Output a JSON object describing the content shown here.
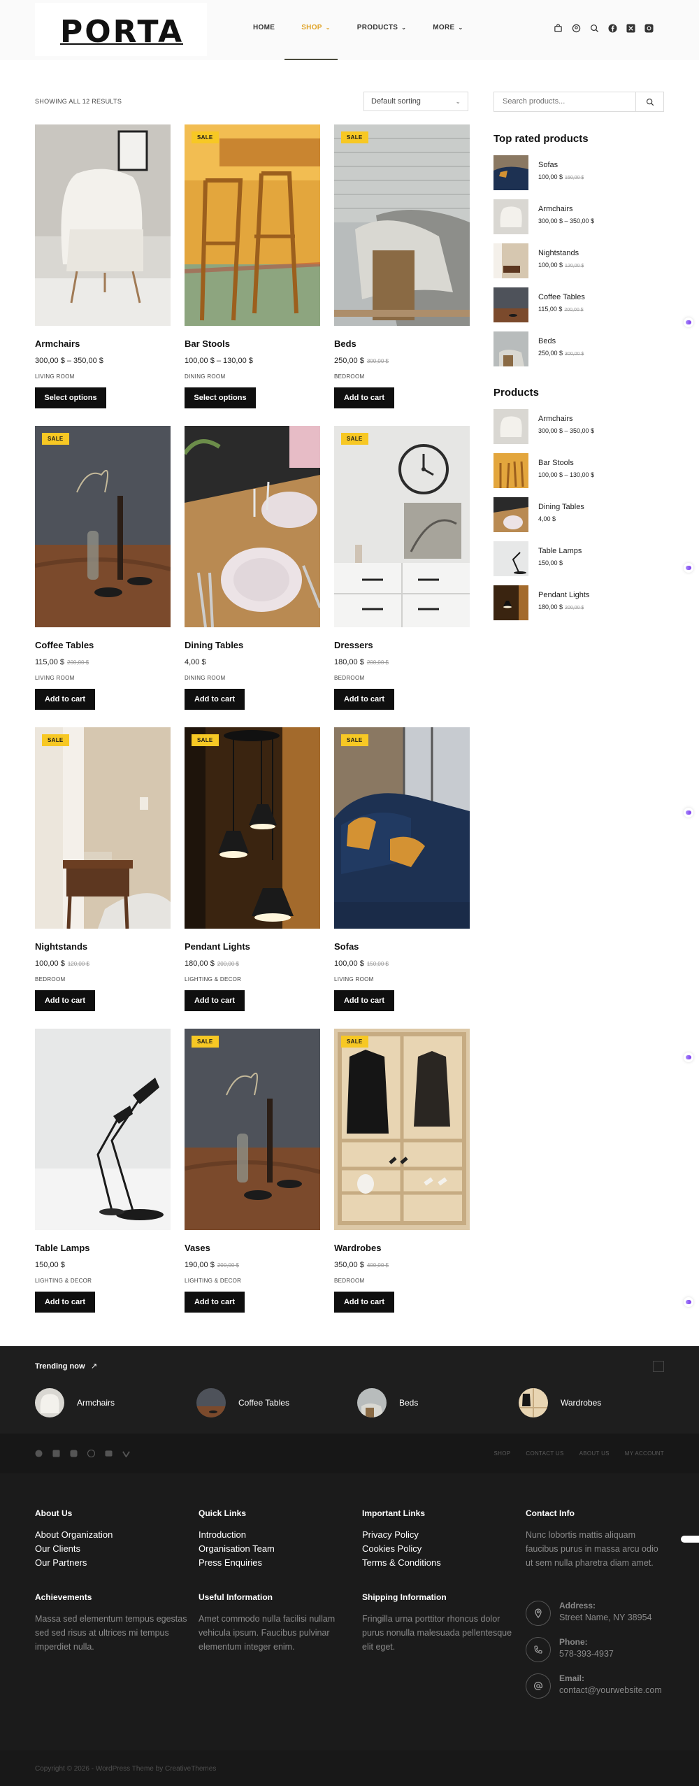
{
  "brand": {
    "logo": "PORTA"
  },
  "nav": {
    "items": [
      {
        "label": "HOME"
      },
      {
        "label": "SHOP"
      },
      {
        "label": "PRODUCTS"
      },
      {
        "label": "MORE"
      }
    ],
    "active": "SHOP",
    "accent_color": "#e0a429"
  },
  "header_icons": [
    "cart-icon",
    "account-icon",
    "search-icon",
    "facebook-icon",
    "x-icon",
    "instagram-icon"
  ],
  "toolbar": {
    "results_text": "SHOWING ALL 12 RESULTS",
    "sort_value": "Default sorting"
  },
  "products": [
    {
      "name": "Armchairs",
      "price": "300,00 $ – 350,00 $",
      "old_price": "",
      "category": "LIVING ROOM",
      "button": "Select options",
      "sale": false
    },
    {
      "name": "Bar Stools",
      "price": "100,00 $ – 130,00 $",
      "old_price": "",
      "category": "DINING ROOM",
      "button": "Select options",
      "sale": true
    },
    {
      "name": "Beds",
      "price": "250,00 $",
      "old_price": "300,00 $",
      "category": "BEDROOM",
      "button": "Add to cart",
      "sale": true
    },
    {
      "name": "Coffee Tables",
      "price": "115,00 $",
      "old_price": "200,00 $",
      "category": "LIVING ROOM",
      "button": "Add to cart",
      "sale": true
    },
    {
      "name": "Dining Tables",
      "price": "4,00 $",
      "old_price": "",
      "category": "DINING ROOM",
      "button": "Add to cart",
      "sale": false
    },
    {
      "name": "Dressers",
      "price": "180,00 $",
      "old_price": "200,00 $",
      "category": "BEDROOM",
      "button": "Add to cart",
      "sale": true
    },
    {
      "name": "Nightstands",
      "price": "100,00 $",
      "old_price": "120,00 $",
      "category": "BEDROOM",
      "button": "Add to cart",
      "sale": true
    },
    {
      "name": "Pendant Lights",
      "price": "180,00 $",
      "old_price": "200,00 $",
      "category": "LIGHTING & DECOR",
      "button": "Add to cart",
      "sale": true
    },
    {
      "name": "Sofas",
      "price": "100,00 $",
      "old_price": "150,00 $",
      "category": "LIVING ROOM",
      "button": "Add to cart",
      "sale": true
    },
    {
      "name": "Table Lamps",
      "price": "150,00 $",
      "old_price": "",
      "category": "LIGHTING & DECOR",
      "button": "Add to cart",
      "sale": false
    },
    {
      "name": "Vases",
      "price": "190,00 $",
      "old_price": "200,00 $",
      "category": "LIGHTING & DECOR",
      "button": "Add to cart",
      "sale": true
    },
    {
      "name": "Wardrobes",
      "price": "350,00 $",
      "old_price": "400,00 $",
      "category": "BEDROOM",
      "button": "Add to cart",
      "sale": true
    }
  ],
  "sale_label": "SALE",
  "sidebar": {
    "search_placeholder": "Search products...",
    "top_rated_title": "Top rated products",
    "top_rated": [
      {
        "name": "Sofas",
        "price": "100,00 $",
        "old_price": "150,00 $"
      },
      {
        "name": "Armchairs",
        "price": "300,00 $ – 350,00 $",
        "old_price": ""
      },
      {
        "name": "Nightstands",
        "price": "100,00 $",
        "old_price": "120,00 $"
      },
      {
        "name": "Coffee Tables",
        "price": "115,00 $",
        "old_price": "200,00 $"
      },
      {
        "name": "Beds",
        "price": "250,00 $",
        "old_price": "300,00 $"
      }
    ],
    "products_title": "Products",
    "products": [
      {
        "name": "Armchairs",
        "price": "300,00 $ – 350,00 $",
        "old_price": ""
      },
      {
        "name": "Bar Stools",
        "price": "100,00 $ – 130,00 $",
        "old_price": ""
      },
      {
        "name": "Dining Tables",
        "price": "4,00 $",
        "old_price": ""
      },
      {
        "name": "Table Lamps",
        "price": "150,00 $",
        "old_price": ""
      },
      {
        "name": "Pendant Lights",
        "price": "180,00 $",
        "old_price": "200,00 $"
      }
    ]
  },
  "trending": {
    "title": "Trending now",
    "items": [
      "Armchairs",
      "Coffee Tables",
      "Beds",
      "Wardrobes"
    ]
  },
  "subfooter": {
    "social": [
      "facebook-icon",
      "x-icon",
      "instagram-icon",
      "pinterest-icon",
      "youtube-icon",
      "vimeo-icon"
    ],
    "links": [
      "SHOP",
      "CONTACT US",
      "ABOUT US",
      "MY ACCOUNT"
    ]
  },
  "footer": {
    "about": {
      "title": "About Us",
      "links": [
        "About Organization",
        "Our Clients",
        "Our Partners"
      ]
    },
    "quick": {
      "title": "Quick Links",
      "links": [
        "Introduction",
        "Organisation Team",
        "Press Enquiries"
      ]
    },
    "important": {
      "title": "Important Links",
      "links": [
        "Privacy Policy",
        "Cookies Policy",
        "Terms & Conditions"
      ]
    },
    "achievements": {
      "title": "Achievements",
      "text": "Massa sed elementum tempus egestas sed sed risus at ultrices mi tempus imperdiet nulla."
    },
    "useful": {
      "title": "Useful Information",
      "text": "Amet commodo nulla facilisi nullam vehicula ipsum. Faucibus pulvinar elementum integer enim."
    },
    "shipping": {
      "title": "Shipping Information",
      "text": "Fringilla urna porttitor rhoncus dolor purus nonulla malesuada pellentesque elit eget."
    },
    "contact": {
      "title": "Contact Info",
      "text": "Nunc lobortis mattis aliquam faucibus purus in massa arcu odio ut sem nulla pharetra diam amet.",
      "address_label": "Address:",
      "address": "Street Name, NY 38954",
      "phone_label": "Phone:",
      "phone": "578-393-4937",
      "email_label": "Email:",
      "email": "contact@yourwebsite.com"
    }
  },
  "copyright": "Copyright © 2026 - WordPress Theme by CreativeThemes"
}
